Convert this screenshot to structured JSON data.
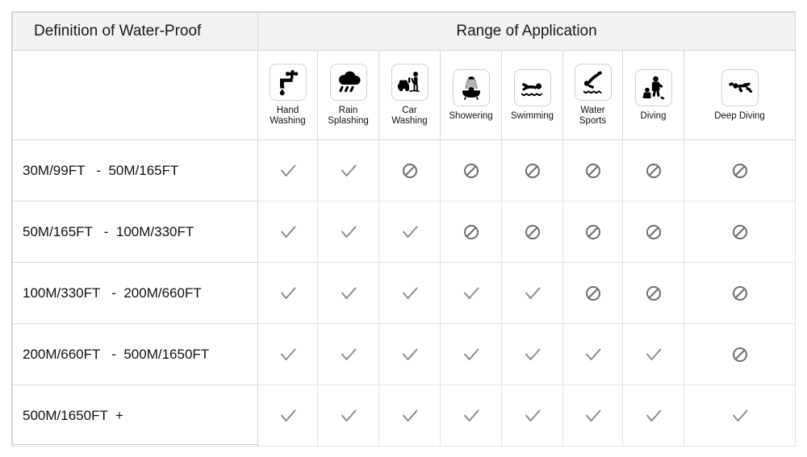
{
  "header": {
    "definition_title": "Definition of Water-Proof",
    "range_title": "Range of Application"
  },
  "columns": [
    {
      "id": "hand-washing",
      "label": "Hand\nWashing",
      "icon": "faucet-icon"
    },
    {
      "id": "rain-splashing",
      "label": "Rain\nSplashing",
      "icon": "rain-cloud-icon"
    },
    {
      "id": "car-washing",
      "label": "Car\nWashing",
      "icon": "car-wash-icon"
    },
    {
      "id": "showering",
      "label": "Showering",
      "icon": "shower-icon"
    },
    {
      "id": "swimming",
      "label": "Swimming",
      "icon": "swimmer-icon"
    },
    {
      "id": "water-sports",
      "label": "Water\nSports",
      "icon": "water-sports-icon"
    },
    {
      "id": "diving",
      "label": "Diving",
      "icon": "diver-icon"
    },
    {
      "id": "deep-diving",
      "label": "Deep Diving",
      "icon": "deep-diver-icon"
    }
  ],
  "rows": [
    {
      "label": "30M/99FT   -  50M/165FT",
      "marks": [
        "check",
        "check",
        "no",
        "no",
        "no",
        "no",
        "no",
        "no"
      ]
    },
    {
      "label": "50M/165FT   -  100M/330FT",
      "marks": [
        "check",
        "check",
        "check",
        "no",
        "no",
        "no",
        "no",
        "no"
      ]
    },
    {
      "label": "100M/330FT   -  200M/660FT",
      "marks": [
        "check",
        "check",
        "check",
        "check",
        "check",
        "no",
        "no",
        "no"
      ]
    },
    {
      "label": "200M/660FT   -  500M/1650FT",
      "marks": [
        "check",
        "check",
        "check",
        "check",
        "check",
        "check",
        "check",
        "no"
      ]
    },
    {
      "label": "500M/1650FT  +",
      "marks": [
        "check",
        "check",
        "check",
        "check",
        "check",
        "check",
        "check",
        "check"
      ]
    }
  ],
  "marks": {
    "check_name": "check-icon",
    "no_name": "prohibited-icon",
    "check_color": "#8a8a8a",
    "no_color": "#6f6f6f"
  },
  "colors": {
    "header_bg": "#f2f2f2",
    "border": "#d8d8d8",
    "cell_border": "#e2e2e2",
    "text": "#1a1a1a",
    "icon": "#000000"
  }
}
